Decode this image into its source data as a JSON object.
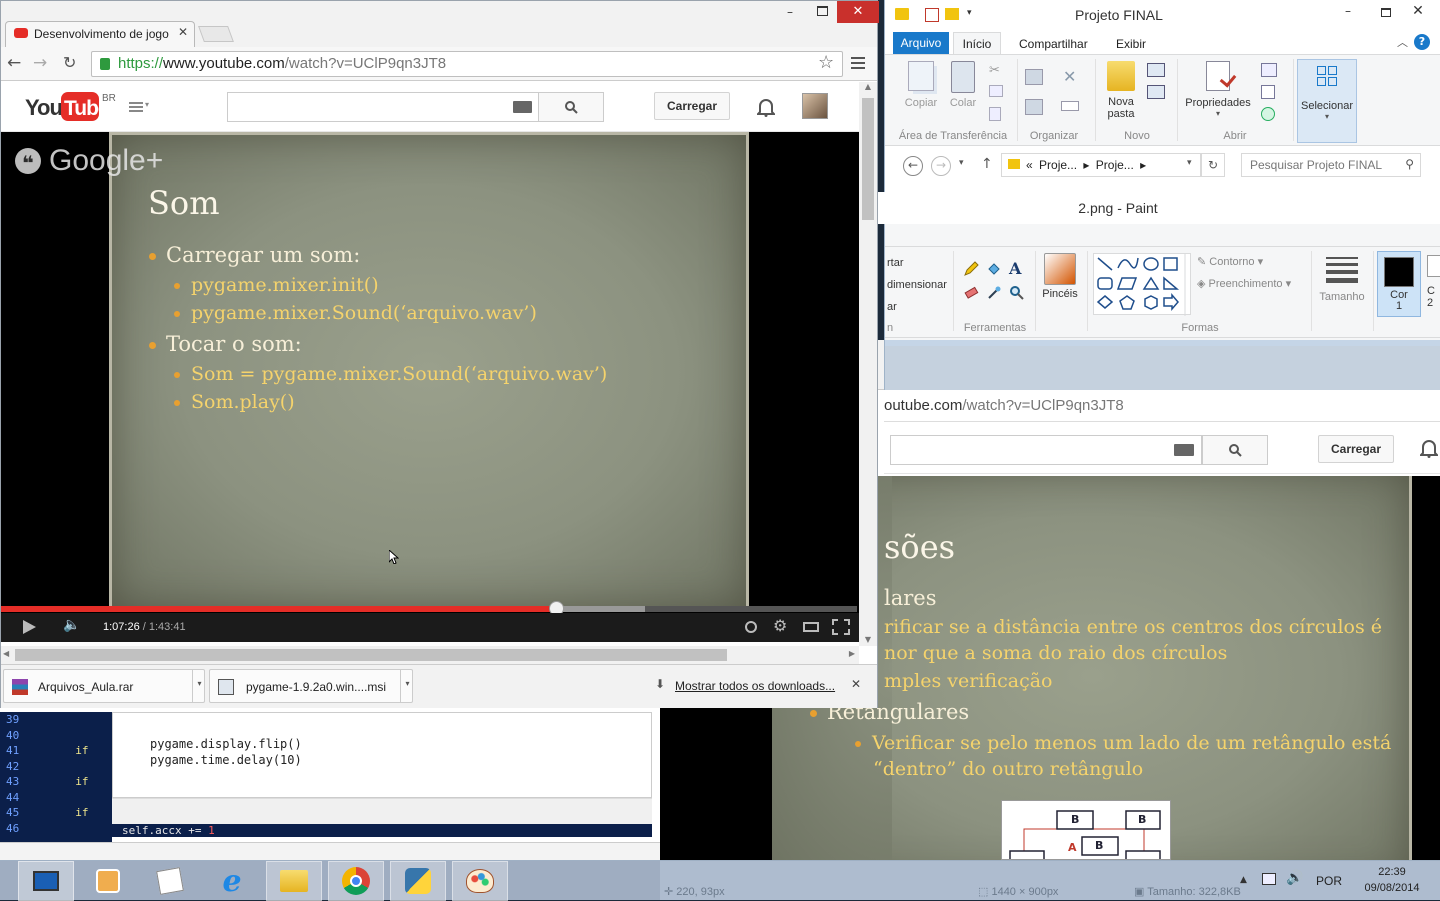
{
  "chrome": {
    "tab_title": "Desenvolvimento de jogo",
    "url_scheme": "https://",
    "url_host": "www.youtube.com",
    "url_path": "/watch?v=UClP9qn3JT8",
    "youtube": {
      "region": "BR",
      "upload_label": "Carregar"
    },
    "slide": {
      "watermark": "Google+",
      "title": "Som",
      "bullet1": "Carregar um som:",
      "bullet1_sub1": "pygame.mixer.init()",
      "bullet1_sub2": "pygame.mixer.Sound(‘arquivo.wav’)",
      "bullet2": "Tocar o som:",
      "bullet2_sub1": "Som = pygame.mixer.Sound(‘arquivo.wav’)",
      "bullet2_sub2": "Som.play()"
    },
    "player": {
      "current_time": "1:07:26",
      "separator": " / ",
      "duration": "1:43:41",
      "progress": 0.648,
      "buffered": 0.752
    },
    "downloads": {
      "item1": "Arquivos_Aula.rar",
      "item2": "pygame-1.9.2a0.win....msi",
      "show_all": "Mostrar todos os downloads..."
    }
  },
  "explorer": {
    "title": "Projeto FINAL",
    "tabs": [
      "Arquivo",
      "Início",
      "Compartilhar",
      "Exibir"
    ],
    "ribbon": {
      "copy": "Copiar",
      "paste": "Colar",
      "new_folder_1": "Nova",
      "new_folder_2": "pasta",
      "properties": "Propriedades",
      "select": "Selecionar",
      "group_clipboard": "Área de Transferência",
      "group_organize": "Organizar",
      "group_new": "Novo",
      "group_open": "Abrir"
    },
    "breadcrumb_prefix": "«",
    "breadcrumb_1": "Proje...",
    "breadcrumb_2": "Proje...",
    "search_placeholder": "Pesquisar Projeto FINAL"
  },
  "paint": {
    "title": "2.png - Paint",
    "partial_1": "rtar",
    "partial_2": "dimensionar",
    "partial_3": "ar",
    "partial_4": "n",
    "tools_group": "Ferramentas",
    "brushes": "Pincéis",
    "outline": "Contorno",
    "fill": "Preenchimento",
    "shapes_group": "Formas",
    "size": "Tamanho",
    "color1_a": "Cor",
    "color1_b": "1",
    "color2_partial": "C",
    "color2_partial_b": "2",
    "status_pos": "220, 93px",
    "status_dim": "1440 × 900px",
    "status_size": "Tamanho: 322,8KB"
  },
  "bg_browser": {
    "url_partial_host": "outube.com",
    "url_path": "/watch?v=UClP9qn3JT8",
    "upload_label": "Carregar",
    "slide": {
      "title_partial": "sões",
      "line1": "lares",
      "line2": "rificar se a distância entre os centros dos círculos é",
      "line3": "nor que a soma do raio dos círculos",
      "line4": "mples verificação",
      "line5": "Retângulares",
      "line6": "Verificar se pelo menos um lado de um retângulo está",
      "line7": "“dentro” do outro retângulo",
      "diagram_b": "B",
      "diagram_a": "A"
    }
  },
  "editor": {
    "line_numbers": [
      "39",
      "40",
      "41",
      "42",
      "43",
      "44",
      "45",
      "46"
    ],
    "code_1": "pygame.display.flip()",
    "code_2": "pygame.time.delay(10)",
    "kw_if": "if",
    "code_bottom": "self.accx += ",
    "code_bottom_num": "1"
  },
  "taskbar": {
    "language": "POR",
    "time": "22:39",
    "date": "09/08/2014"
  }
}
